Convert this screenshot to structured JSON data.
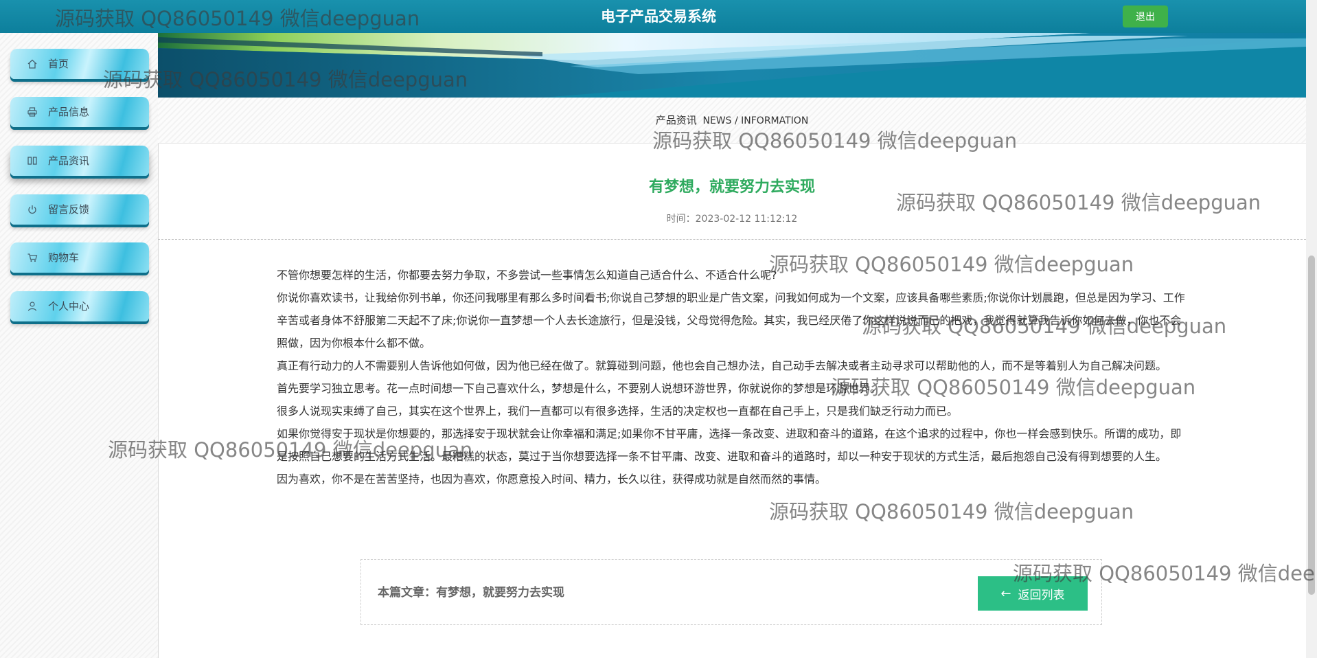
{
  "header": {
    "title": "电子产品交易系统",
    "logout_label": "退出"
  },
  "sidebar": {
    "items": [
      {
        "label": "首页",
        "icon": "home-icon"
      },
      {
        "label": "产品信息",
        "icon": "printer-icon"
      },
      {
        "label": "产品资讯",
        "icon": "columns-icon",
        "active": true
      },
      {
        "label": "留言反馈",
        "icon": "power-icon"
      },
      {
        "label": "购物车",
        "icon": "cart-icon"
      },
      {
        "label": "个人中心",
        "icon": "user-icon"
      }
    ]
  },
  "section": {
    "label": "产品资讯",
    "subtitle": "NEWS / INFORMATION"
  },
  "article": {
    "title": "有梦想，就要努力去实现",
    "time_label": "时间：",
    "time": "2023-02-12 11:12:12",
    "paragraphs": [
      "不管你想要怎样的生活，你都要去努力争取，不多尝试一些事情怎么知道自己适合什么、不适合什么呢?",
      "你说你喜欢读书，让我给你列书单，你还问我哪里有那么多时间看书;你说自己梦想的职业是广告文案，问我如何成为一个文案，应该具备哪些素质;你说你计划晨跑，但总是因为学习、工作辛苦或者身体不舒服第二天起不了床;你说你一直梦想一个人去长途旅行，但是没钱，父母觉得危险。其实，我已经厌倦了你这样说说而已的把戏，我觉得就算我告诉你如何去做，你也不会照做，因为你根本什么都不做。",
      "真正有行动力的人不需要别人告诉他如何做，因为他已经在做了。就算碰到问题，他也会自己想办法，自己动手去解决或者主动寻求可以帮助他的人，而不是等着别人为自己解决问题。",
      "首先要学习独立思考。花一点时间想一下自己喜欢什么，梦想是什么，不要别人说想环游世界，你就说你的梦想是环游世界。",
      "很多人说现实束缚了自己，其实在这个世界上，我们一直都可以有很多选择，生活的决定权也一直都在自己手上，只是我们缺乏行动力而已。",
      "如果你觉得安于现状是你想要的，那选择安于现状就会让你幸福和满足;如果你不甘平庸，选择一条改变、进取和奋斗的道路，在这个追求的过程中，你也一样会感到快乐。所谓的成功，即是按照自己想要的生活方式生活。最糟糕的状态，莫过于当你想要选择一条不甘平庸、改变、进取和奋斗的道路时，却以一种安于现状的方式生活，最后抱怨自己没有得到想要的人生。",
      "因为喜欢，你不是在苦苦坚持，也因为喜欢，你愿意投入时间、精力，长久以往，获得成功就是自然而然的事情。"
    ]
  },
  "footer": {
    "current_label": "本篇文章：有梦想，就要努力去实现",
    "back_label": "返回列表"
  },
  "watermark": {
    "text": "源码获取 QQ86050149 微信deepguan",
    "text_clipped": "源码获取 QQ86050149 微信dee"
  },
  "colors": {
    "header": "#1288a6",
    "accent_green": "#2eaa5e",
    "button_green": "#2cbf86",
    "logout_green": "#3fb14a"
  }
}
